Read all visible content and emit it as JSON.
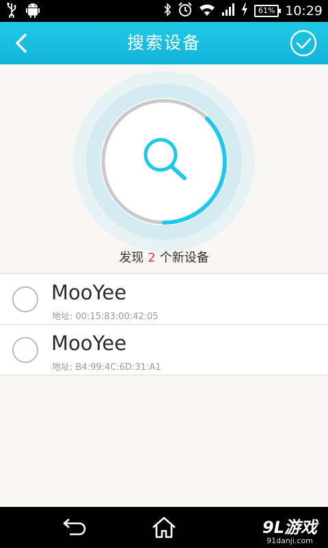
{
  "status_bar": {
    "time": "10:29",
    "battery": "61%",
    "icons": [
      "usb-icon",
      "android-icon",
      "bluetooth-icon",
      "alarm-icon",
      "wifi-icon",
      "signal-icon",
      "charging-icon"
    ]
  },
  "header": {
    "title": "搜索设备",
    "back_icon": "chevron-left-icon",
    "confirm_icon": "check-circle-icon"
  },
  "scan": {
    "icon": "search-icon",
    "progress": 0.75,
    "accent_color": "#1ec8ea"
  },
  "found": {
    "prefix": "发现",
    "count": "2",
    "suffix": "个新设备"
  },
  "devices": [
    {
      "name": "MooYee",
      "address": "地址: 00:15:83:00:42:05"
    },
    {
      "name": "MooYee",
      "address": "地址: B4:99:4C:6D:31:A1"
    }
  ],
  "nav_bar": {
    "watermark_brand": "9L游戏",
    "watermark_site": "91danji.com"
  },
  "colors": {
    "header": "#1abde0",
    "count_highlight": "#e8393f",
    "background": "#f7f6f2"
  }
}
